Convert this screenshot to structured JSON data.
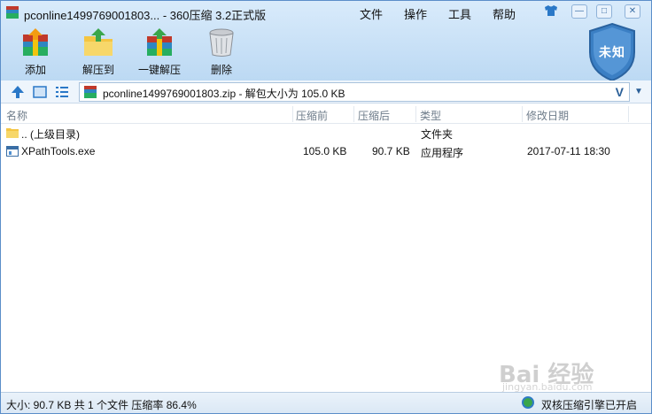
{
  "window": {
    "title": "pconline1499769001803... - 360压缩 3.2正式版",
    "menus": [
      "文件",
      "操作",
      "工具",
      "帮助"
    ],
    "buttons": {
      "minimize": "—",
      "maximize": "□",
      "close": "✕"
    }
  },
  "toolbar": {
    "add": "添加",
    "extract_to": "解压到",
    "one_click_extract": "一键解压",
    "delete": "删除"
  },
  "badge": {
    "label": "未知"
  },
  "address": {
    "path": "pconline1499769001803.zip - 解包大小为 105.0 KB",
    "dropdown_glyph": "V"
  },
  "columns": [
    "名称",
    "压缩前",
    "压缩后",
    "类型",
    "修改日期"
  ],
  "rows": [
    {
      "name": ".. (上级目录)",
      "before": "",
      "after": "",
      "type": "文件夹",
      "date": ""
    },
    {
      "name": "XPathTools.exe",
      "before": "105.0 KB",
      "after": "90.7 KB",
      "type": "应用程序",
      "date": "2017-07-11 18:30"
    }
  ],
  "status": {
    "left": "大小: 90.7 KB 共 1 个文件 压缩率 86.4%",
    "right": "双核压缩引擎已开启"
  },
  "watermark": {
    "text": "Bai 经验",
    "sub": "jingyan.baidu.com"
  },
  "colors": {
    "accent": "#2a78c7",
    "badge": "#3b7fc4",
    "header_text": "#6e7c8a"
  }
}
